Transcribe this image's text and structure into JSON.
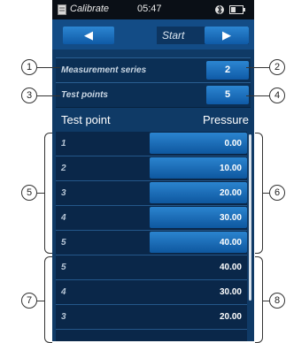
{
  "status_bar": {
    "app_name": "Calibrate",
    "time": "05:47"
  },
  "nav": {
    "prev_label": "◀",
    "center_label": "Start",
    "next_label": "▶"
  },
  "params": [
    {
      "label": "Measurement series",
      "value": "2"
    },
    {
      "label": "Test points",
      "value": "5"
    }
  ],
  "table": {
    "headers": {
      "test_point": "Test point",
      "pressure": "Pressure"
    },
    "rows_up": [
      {
        "index": "1",
        "value": "0.00"
      },
      {
        "index": "2",
        "value": "10.00"
      },
      {
        "index": "3",
        "value": "20.00"
      },
      {
        "index": "4",
        "value": "30.00"
      },
      {
        "index": "5",
        "value": "40.00"
      }
    ],
    "rows_down": [
      {
        "index": "5",
        "value": "40.00"
      },
      {
        "index": "4",
        "value": "30.00"
      },
      {
        "index": "3",
        "value": "20.00"
      }
    ]
  },
  "callouts": [
    "1",
    "2",
    "3",
    "4",
    "5",
    "6",
    "7",
    "8"
  ]
}
